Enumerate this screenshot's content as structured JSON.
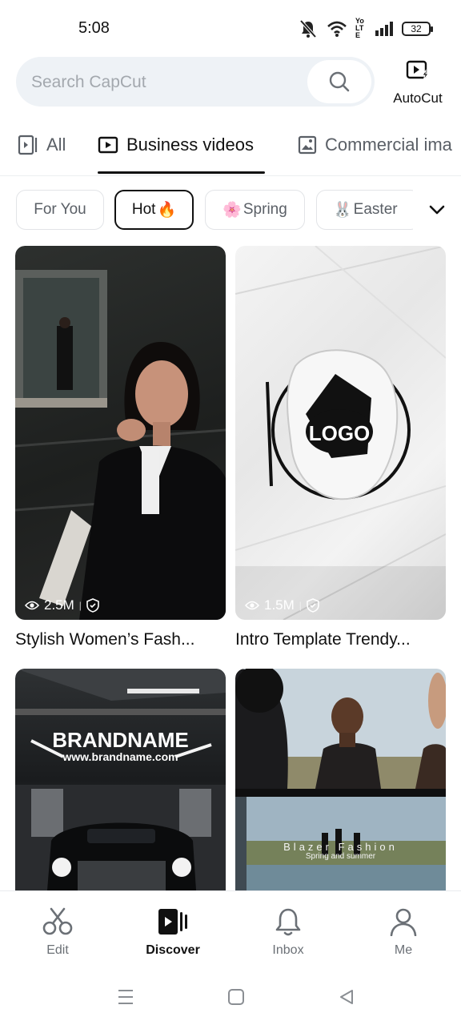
{
  "status_bar": {
    "time": "5:08",
    "volte_label": "Yo LTE",
    "battery": "32"
  },
  "search": {
    "placeholder": "Search CapCut"
  },
  "autocut": {
    "label": "AutoCut"
  },
  "category_tabs": [
    {
      "label": "All",
      "icon": "phone-frame-icon"
    },
    {
      "label": "Business videos",
      "icon": "play-box-icon",
      "active": true
    },
    {
      "label": "Commercial ima",
      "icon": "image-icon"
    }
  ],
  "chips": [
    {
      "label": "For You"
    },
    {
      "label": "Hot",
      "emoji": "🔥",
      "active": true
    },
    {
      "label": "Spring",
      "emoji": "🌸"
    },
    {
      "label": "Easter",
      "emoji": "🐰"
    }
  ],
  "cards": [
    {
      "title": "Stylish Women’s Fash...",
      "views": "2.5M"
    },
    {
      "title": "Intro Template Trendy...",
      "views": "1.5M",
      "overlay_text": "LOGO"
    },
    {
      "overlay_title": "BRANDNAME",
      "overlay_url": "www.brandname.com"
    },
    {
      "overlay_title": "Blazer Fashion",
      "overlay_subtitle": "Spring and summer"
    }
  ],
  "bottom_nav": [
    {
      "label": "Edit",
      "icon": "scissors-icon"
    },
    {
      "label": "Discover",
      "icon": "discover-icon",
      "active": true
    },
    {
      "label": "Inbox",
      "icon": "bell-icon"
    },
    {
      "label": "Me",
      "icon": "person-icon"
    }
  ],
  "colors": {
    "search_bg": "#eef2f6",
    "active_text": "#111111",
    "muted_text": "#6b7076",
    "chip_border": "#e2e4e7"
  }
}
